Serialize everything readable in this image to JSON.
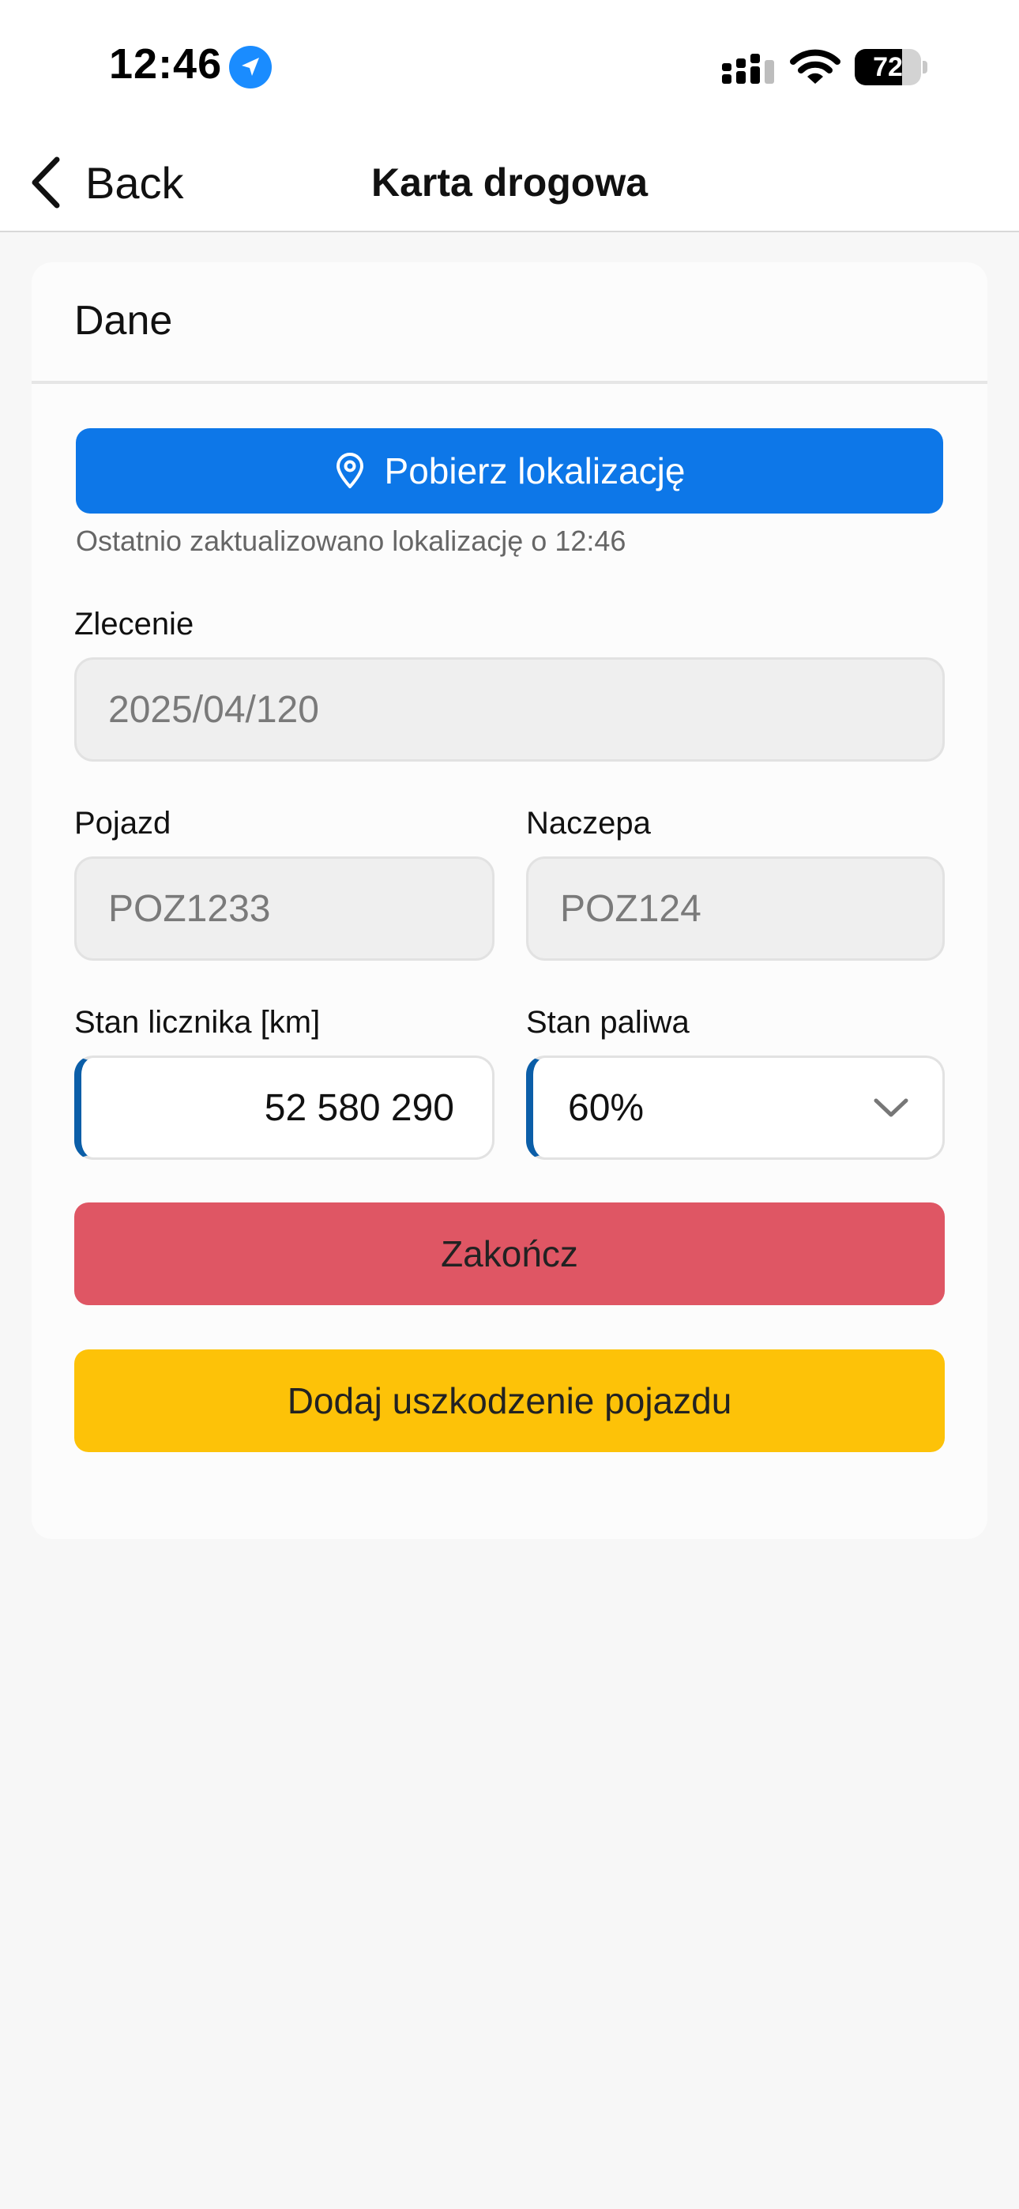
{
  "status_bar": {
    "time": "12:46",
    "battery": "72",
    "battery_level": 0.72,
    "icons": [
      "location-arrow-icon",
      "signal-icon",
      "wifi-icon",
      "battery-icon"
    ]
  },
  "nav": {
    "back_label": "Back",
    "title": "Karta drogowa"
  },
  "card": {
    "title": "Dane",
    "location_button": "Pobierz lokalizację",
    "location_note": "Ostatnio zaktualizowano lokalizację o 12:46",
    "order": {
      "label": "Zlecenie",
      "value": "2025/04/120"
    },
    "vehicle": {
      "label": "Pojazd",
      "value": "POZ1233"
    },
    "trailer": {
      "label": "Naczepa",
      "value": "POZ124"
    },
    "odometer": {
      "label": "Stan licznika [km]",
      "value": "52 580 290"
    },
    "fuel": {
      "label": "Stan paliwa",
      "value": "60%"
    },
    "finish_button": "Zakończ",
    "damage_button": "Dodaj uszkodzenie pojazdu"
  },
  "colors": {
    "primary_blue": "#0d77e8",
    "finish_red": "#df5664",
    "damage_yellow": "#fdc208",
    "active_border": "#0b5ea8"
  }
}
